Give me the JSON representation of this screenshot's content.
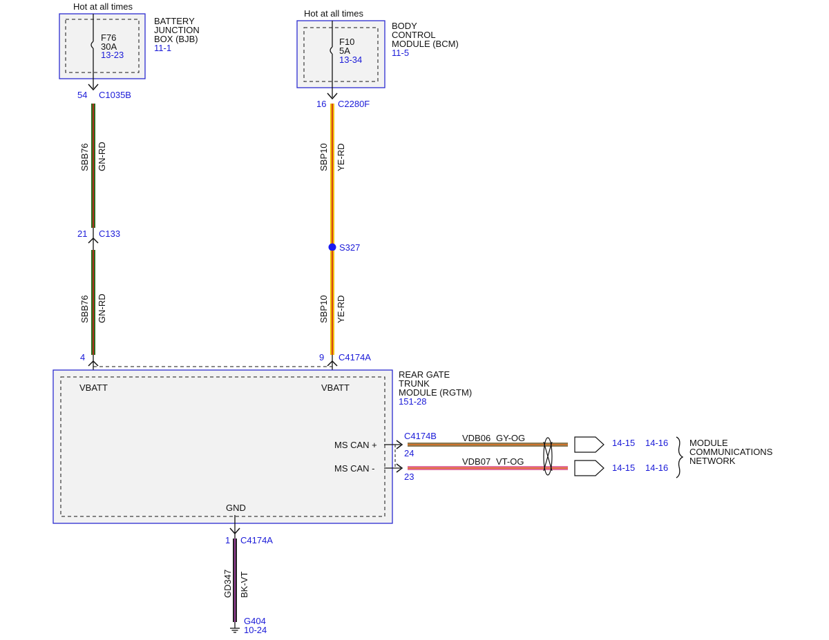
{
  "bjb": {
    "hot_label": "Hot at all times",
    "name_line1": "BATTERY",
    "name_line2": "JUNCTION",
    "name_line3": "BOX (BJB)",
    "ref": "11-1",
    "fuse_id": "F76",
    "fuse_rating": "30A",
    "fuse_ref": "13-23"
  },
  "bcm": {
    "hot_label": "Hot at all times",
    "name_line1": "BODY",
    "name_line2": "CONTROL",
    "name_line3": "MODULE (BCM)",
    "ref": "11-5",
    "fuse_id": "F10",
    "fuse_rating": "5A",
    "fuse_ref": "13-34"
  },
  "left_circuit": {
    "pin_top": "54",
    "connector_top": "C1035B",
    "circuit": "SBB76",
    "color": "GN-RD",
    "pin_mid": "21",
    "connector_mid": "C133",
    "pin_bottom": "4",
    "wire_color_a": "#2e6b1e",
    "wire_color_b": "#cc2222"
  },
  "right_circuit": {
    "pin_top": "16",
    "connector_top": "C2280F",
    "circuit": "SBP10",
    "color": "YE-RD",
    "splice": "S327",
    "pin_bottom": "9",
    "connector_bottom": "C4174A",
    "wire_color_a": "#f2c200",
    "wire_color_b": "#cc2222"
  },
  "rgtm": {
    "name_line1": "REAR GATE",
    "name_line2": "TRUNK",
    "name_line3": "MODULE (RGTM)",
    "ref": "151-28",
    "vbatt_left": "VBATT",
    "vbatt_right": "VBATT",
    "ms_can_plus": "MS CAN +",
    "ms_can_minus": "MS CAN -",
    "gnd": "GND"
  },
  "can": {
    "connector": "C4174B",
    "pin_plus": "24",
    "pin_minus": "23",
    "plus_circuit": "VDB06",
    "plus_color": "GY-OG",
    "minus_circuit": "VDB07",
    "minus_color": "VT-OG",
    "plus_ref1": "14-15",
    "plus_ref2": "14-16",
    "minus_ref1": "14-15",
    "minus_ref2": "14-16",
    "network_line1": "MODULE",
    "network_line2": "COMMUNICATIONS",
    "network_line3": "NETWORK",
    "gy_color": "#8a7a55",
    "vt_color": "#e070a0"
  },
  "ground": {
    "pin": "1",
    "connector": "C4174A",
    "circuit": "GD347",
    "color": "BK-VT",
    "point": "G404",
    "ref": "10-24",
    "wire_color_a": "#222222",
    "wire_color_b": "#b040b0"
  },
  "colors": {
    "box_border": "#2a2ad0",
    "link_text": "#1a1ad8",
    "module_fill": "#f2f2f2"
  }
}
